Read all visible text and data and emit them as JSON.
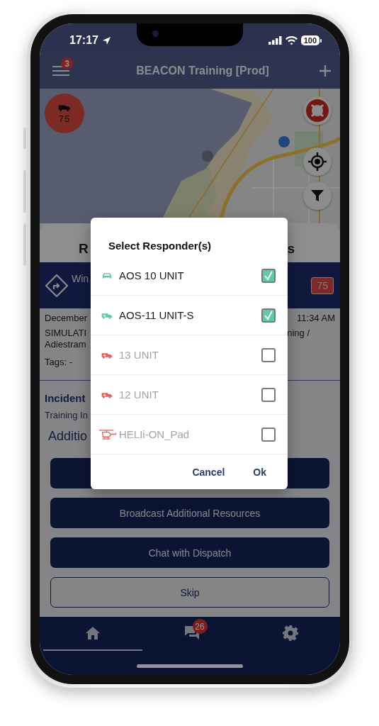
{
  "status_bar": {
    "time": "17:17",
    "battery": "100"
  },
  "header": {
    "title": "BEACON Training [Prod]",
    "menu_badge": "3"
  },
  "map": {
    "kind": "picture",
    "unit_marker": {
      "count": "75"
    }
  },
  "panel": {
    "title_start": "R",
    "title_end": "s",
    "incident": {
      "title": "Win",
      "priority": "75"
    },
    "details": {
      "date": "December",
      "time": "11:34 AM",
      "description_start": "SIMULATI",
      "description_end": "ning /",
      "description_line_2": "Adiestram",
      "tags": "Tags: -"
    },
    "incident_heading": "Incident",
    "incident_type": "Training In",
    "additional_heading": "Additio",
    "buttons": [
      {
        "kind": "filled"
      },
      {
        "kind": "filled",
        "label": "Broadcast Additional Resources"
      },
      {
        "kind": "filled",
        "label": "Chat with Dispatch"
      },
      {
        "kind": "outlined",
        "label": "Skip"
      }
    ]
  },
  "tab_bar": {
    "tabs": [
      {
        "selected": true
      },
      {
        "selected": false,
        "badge": "26"
      },
      {
        "selected": false
      }
    ]
  },
  "dialog": {
    "title": "Select Responder(s)",
    "responders": [
      {
        "name": "AOS 10 UNIT",
        "kind": "car",
        "color": "#5cc9a7",
        "available": true,
        "checked": true
      },
      {
        "name": "AOS-11 UNIT-S",
        "kind": "truck",
        "color": "#5cc9a7",
        "available": true,
        "checked": true
      },
      {
        "name": "13 UNIT",
        "kind": "truck",
        "color": "#e8605a",
        "available": false,
        "checked": false
      },
      {
        "name": "12 UNIT",
        "kind": "truck",
        "color": "#e8605a",
        "available": false,
        "checked": false
      },
      {
        "name": "HELIi-ON_Pad",
        "kind": "helicopter",
        "color": "#e8605a",
        "available": false,
        "checked": false
      }
    ],
    "buttons": [
      "Cancel",
      "Ok"
    ]
  }
}
